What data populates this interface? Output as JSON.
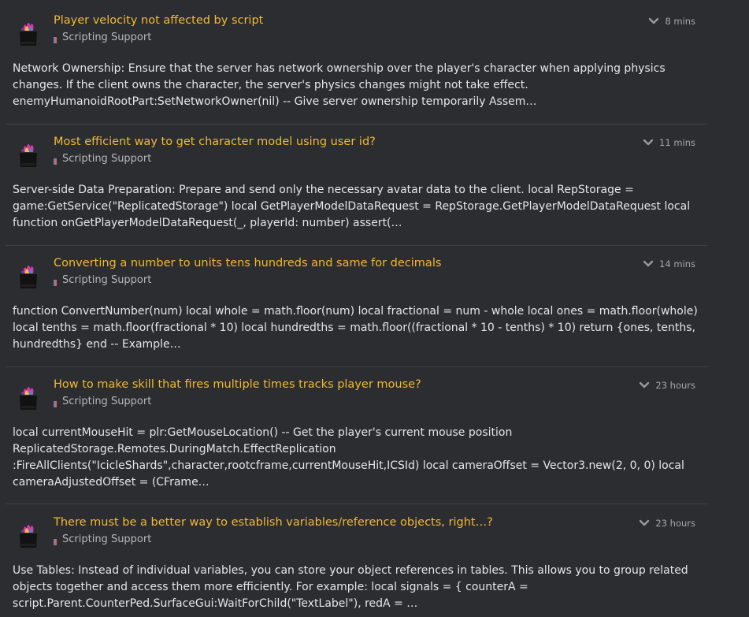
{
  "category": {
    "label": "Scripting Support",
    "mark_colors": [
      "#5b84c9",
      "#e0605a"
    ]
  },
  "colors": {
    "title": "#f3b933",
    "background": "#2b2d31"
  },
  "posts": [
    {
      "title": "Player velocity not affected by script",
      "time": "8 mins",
      "excerpt": "Network Ownership: Ensure that the server has network ownership over the player's character when applying physics changes. If the client owns the character, the server's physics changes might not take effect. enemyHumanoidRootPart:SetNetworkOwner(nil) -- Give server ownership temporarily Assem…"
    },
    {
      "title": "Most efficient way to get character model using user id?",
      "time": "11 mins",
      "excerpt": "Server-side Data Preparation: Prepare and send only the necessary avatar data to the client. local RepStorage = game:GetService(\"ReplicatedStorage\") local GetPlayerModelDataRequest = RepStorage.GetPlayerModelDataRequest local function onGetPlayerModelDataRequest(_, playerId: number) assert(…"
    },
    {
      "title": "Converting a number to units tens hundreds and same for decimals",
      "time": "14 mins",
      "excerpt": "function ConvertNumber(num) local whole = math.floor(num) local fractional = num - whole local ones = math.floor(whole) local tenths = math.floor(fractional * 10) local hundredths = math.floor((fractional * 10 - tenths) * 10) return {ones, tenths, hundredths} end -- Example…"
    },
    {
      "title": "How to make skill that fires multiple times tracks player mouse?",
      "time": "23 hours",
      "excerpt": "local currentMouseHit = plr:GetMouseLocation() -- Get the player's current mouse position ReplicatedStorage.Remotes.DuringMatch.EffectReplication :FireAllClients(\"IcicleShards\",character,rootcframe,currentMouseHit,ICSId) local cameraOffset = Vector3.new(2, 0, 0) local cameraAdjustedOffset = (CFrame…"
    },
    {
      "title": "There must be a better way to establish variables/reference objects, right…?",
      "time": "23 hours",
      "excerpt": "Use Tables: Instead of individual variables, you can store your object references in tables. This allows you to group related objects together and access them more efficiently. For example: local signals = { counterA = script.Parent.CounterPed.SurfaceGui:WaitForChild(\"TextLabel\"), redA = …"
    }
  ]
}
